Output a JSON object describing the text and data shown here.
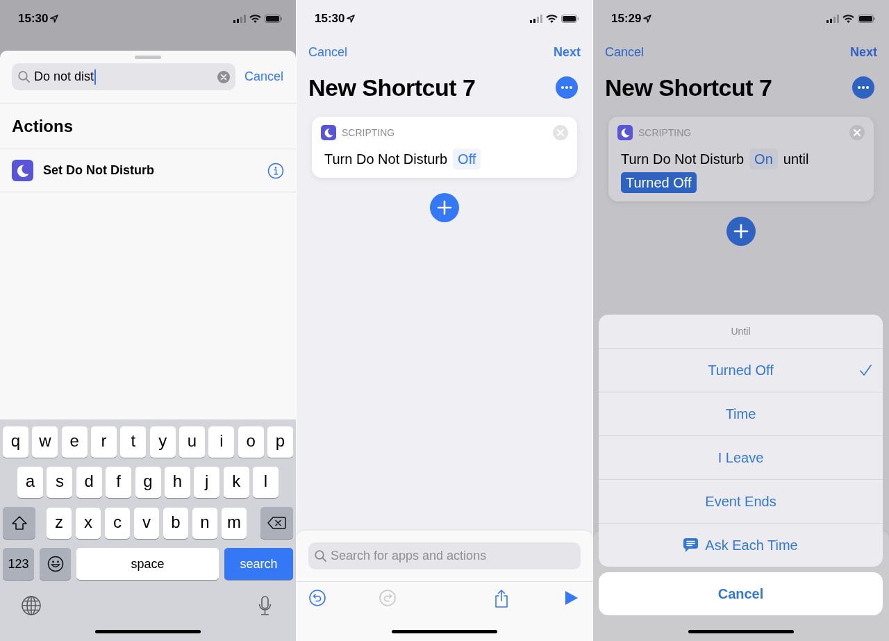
{
  "search_screen": {
    "status_bar": {
      "time": "15:30"
    },
    "search": {
      "value": "Do not dist",
      "cancel": "Cancel"
    },
    "section_title": "Actions",
    "results": [
      {
        "label": "Set Do Not Disturb"
      }
    ],
    "keyboard": {
      "letter_rows": [
        [
          "q",
          "w",
          "e",
          "r",
          "t",
          "y",
          "u",
          "i",
          "o",
          "p"
        ],
        [
          "a",
          "s",
          "d",
          "f",
          "g",
          "h",
          "j",
          "k",
          "l"
        ],
        [
          "z",
          "x",
          "c",
          "v",
          "b",
          "n",
          "m"
        ]
      ],
      "numbers_key": "123",
      "space_key": "space",
      "action_key": "search"
    }
  },
  "editor_screen": {
    "status_bar": {
      "time": "15:30"
    },
    "nav": {
      "cancel": "Cancel",
      "next": "Next"
    },
    "title": "New Shortcut 7",
    "action": {
      "category": "SCRIPTING",
      "tokens": [
        {
          "kind": "text",
          "text": "Turn Do Not Disturb"
        },
        {
          "kind": "param",
          "text": "Off",
          "selected": false
        }
      ]
    },
    "search": {
      "placeholder": "Search for apps and actions"
    },
    "toolbar": [
      {
        "kind": "undo",
        "disabled": false
      },
      {
        "kind": "redo",
        "disabled": true
      },
      {
        "kind": "share",
        "disabled": false
      },
      {
        "kind": "run",
        "disabled": false
      }
    ]
  },
  "picker_screen": {
    "status_bar": {
      "time": "15:29"
    },
    "nav": {
      "cancel": "Cancel",
      "next": "Next"
    },
    "title": "New Shortcut 7",
    "action": {
      "category": "SCRIPTING",
      "tokens": [
        {
          "kind": "text",
          "text": "Turn Do Not Disturb"
        },
        {
          "kind": "param",
          "text": "On",
          "selected": false
        },
        {
          "kind": "text",
          "text": "until"
        },
        {
          "kind": "param",
          "text": "Turned Off",
          "selected": true
        }
      ]
    },
    "menu": {
      "title": "Until",
      "options": [
        {
          "label": "Turned Off",
          "selected": true,
          "kind": "plain"
        },
        {
          "label": "Time",
          "selected": false,
          "kind": "plain"
        },
        {
          "label": "I Leave",
          "selected": false,
          "kind": "plain"
        },
        {
          "label": "Event Ends",
          "selected": false,
          "kind": "plain"
        },
        {
          "label": "Ask Each Time",
          "selected": false,
          "kind": "ask"
        }
      ],
      "cancel": "Cancel"
    }
  }
}
